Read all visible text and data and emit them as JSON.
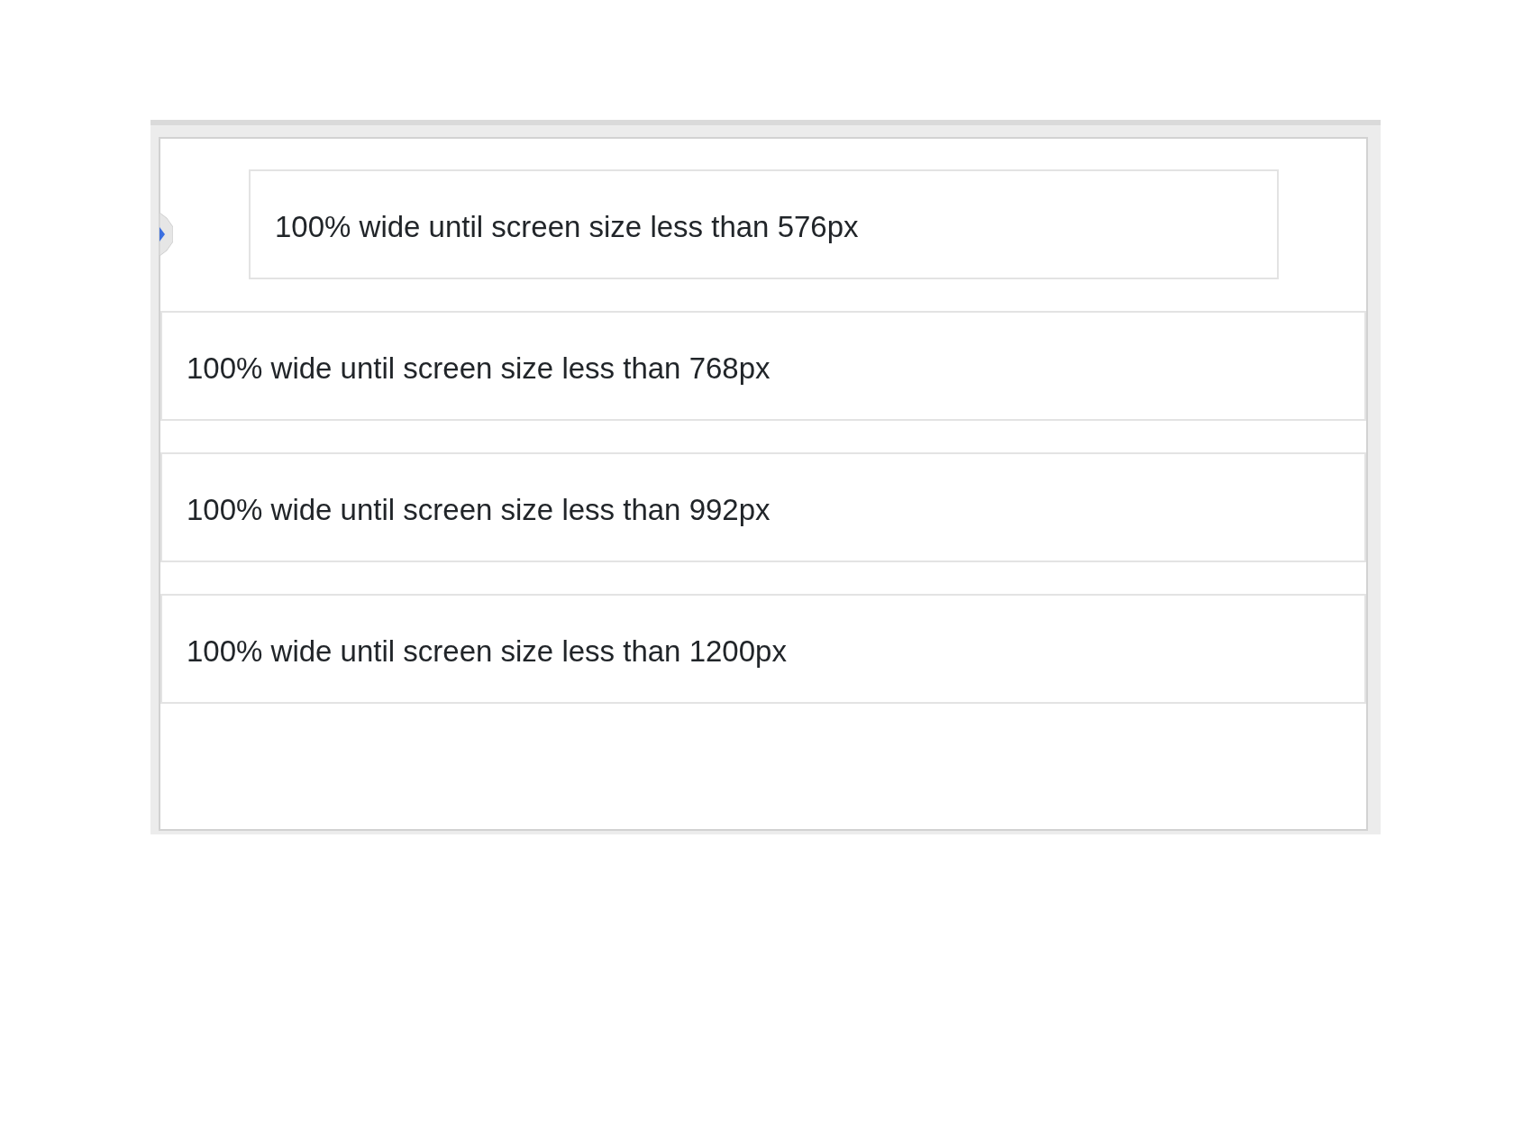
{
  "preview": {
    "rows": [
      {
        "kind": "centered",
        "text": "100% wide until screen size less than 576px"
      },
      {
        "kind": "full",
        "text": "100% wide until screen size less than 768px"
      },
      {
        "kind": "full",
        "text": "100% wide until screen size less than 992px"
      },
      {
        "kind": "full",
        "text": "100% wide until screen size less than 1200px"
      }
    ]
  }
}
